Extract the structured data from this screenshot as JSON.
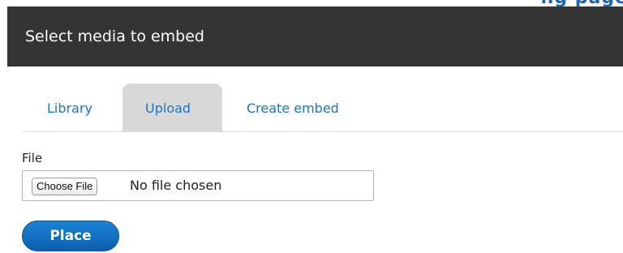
{
  "dialog": {
    "title": "Select media to embed"
  },
  "background_fragment": {
    "text": "ng page"
  },
  "tabs": [
    {
      "label": "Library",
      "active": false
    },
    {
      "label": "Upload",
      "active": true
    },
    {
      "label": "Create embed",
      "active": false
    }
  ],
  "form": {
    "file_label": "File",
    "choose_file_button": "Choose File",
    "file_status": "No file chosen",
    "submit_label": "Place"
  },
  "colors": {
    "title_bar": "#343434",
    "active_tab": "#d8d8d8",
    "link": "#1b74c7",
    "primary_button": "#1a83d5"
  }
}
